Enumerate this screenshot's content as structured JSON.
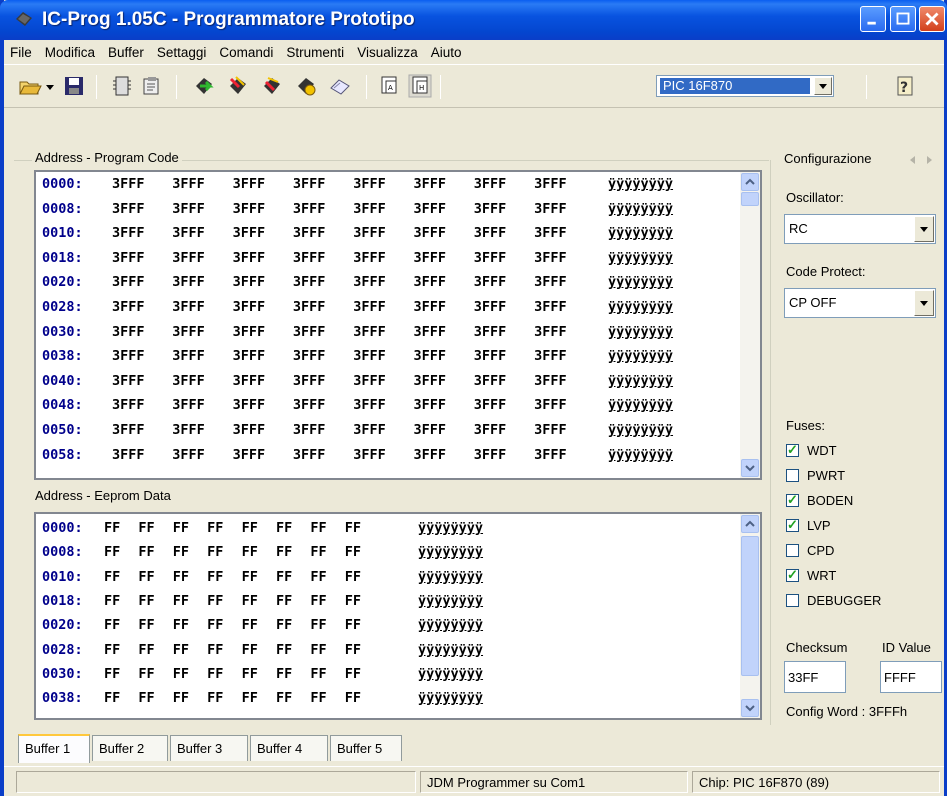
{
  "window": {
    "title": "IC-Prog 1.05C - Programmatore Prototipo"
  },
  "menu": [
    "File",
    "Modifica",
    "Buffer",
    "Settaggi",
    "Comandi",
    "Strumenti",
    "Visualizza",
    "Aiuto"
  ],
  "toolbar": {
    "chip": "PIC 16F870",
    "icons": [
      "open-icon",
      "dropdown-arrow-icon",
      "save-icon",
      "config-icon",
      "settings-icon",
      "read-chip-icon",
      "program-chip-icon",
      "erase-chip-icon",
      "verify-chip-icon",
      "blank-check-icon",
      "view-buffer-icon",
      "view-hex-icon",
      "help-icon"
    ]
  },
  "program_code": {
    "label": "Address - Program Code",
    "rows": [
      {
        "addr": "0000:",
        "words": [
          "3FFF",
          "3FFF",
          "3FFF",
          "3FFF",
          "3FFF",
          "3FFF",
          "3FFF",
          "3FFF"
        ],
        "ascii": "ÿÿÿÿÿÿÿÿ"
      },
      {
        "addr": "0008:",
        "words": [
          "3FFF",
          "3FFF",
          "3FFF",
          "3FFF",
          "3FFF",
          "3FFF",
          "3FFF",
          "3FFF"
        ],
        "ascii": "ÿÿÿÿÿÿÿÿ"
      },
      {
        "addr": "0010:",
        "words": [
          "3FFF",
          "3FFF",
          "3FFF",
          "3FFF",
          "3FFF",
          "3FFF",
          "3FFF",
          "3FFF"
        ],
        "ascii": "ÿÿÿÿÿÿÿÿ"
      },
      {
        "addr": "0018:",
        "words": [
          "3FFF",
          "3FFF",
          "3FFF",
          "3FFF",
          "3FFF",
          "3FFF",
          "3FFF",
          "3FFF"
        ],
        "ascii": "ÿÿÿÿÿÿÿÿ"
      },
      {
        "addr": "0020:",
        "words": [
          "3FFF",
          "3FFF",
          "3FFF",
          "3FFF",
          "3FFF",
          "3FFF",
          "3FFF",
          "3FFF"
        ],
        "ascii": "ÿÿÿÿÿÿÿÿ"
      },
      {
        "addr": "0028:",
        "words": [
          "3FFF",
          "3FFF",
          "3FFF",
          "3FFF",
          "3FFF",
          "3FFF",
          "3FFF",
          "3FFF"
        ],
        "ascii": "ÿÿÿÿÿÿÿÿ"
      },
      {
        "addr": "0030:",
        "words": [
          "3FFF",
          "3FFF",
          "3FFF",
          "3FFF",
          "3FFF",
          "3FFF",
          "3FFF",
          "3FFF"
        ],
        "ascii": "ÿÿÿÿÿÿÿÿ"
      },
      {
        "addr": "0038:",
        "words": [
          "3FFF",
          "3FFF",
          "3FFF",
          "3FFF",
          "3FFF",
          "3FFF",
          "3FFF",
          "3FFF"
        ],
        "ascii": "ÿÿÿÿÿÿÿÿ"
      },
      {
        "addr": "0040:",
        "words": [
          "3FFF",
          "3FFF",
          "3FFF",
          "3FFF",
          "3FFF",
          "3FFF",
          "3FFF",
          "3FFF"
        ],
        "ascii": "ÿÿÿÿÿÿÿÿ"
      },
      {
        "addr": "0048:",
        "words": [
          "3FFF",
          "3FFF",
          "3FFF",
          "3FFF",
          "3FFF",
          "3FFF",
          "3FFF",
          "3FFF"
        ],
        "ascii": "ÿÿÿÿÿÿÿÿ"
      },
      {
        "addr": "0050:",
        "words": [
          "3FFF",
          "3FFF",
          "3FFF",
          "3FFF",
          "3FFF",
          "3FFF",
          "3FFF",
          "3FFF"
        ],
        "ascii": "ÿÿÿÿÿÿÿÿ"
      },
      {
        "addr": "0058:",
        "words": [
          "3FFF",
          "3FFF",
          "3FFF",
          "3FFF",
          "3FFF",
          "3FFF",
          "3FFF",
          "3FFF"
        ],
        "ascii": "ÿÿÿÿÿÿÿÿ"
      }
    ]
  },
  "eeprom": {
    "label": "Address - Eeprom Data",
    "rows": [
      {
        "addr": "0000:",
        "bytes": [
          "FF",
          "FF",
          "FF",
          "FF",
          "FF",
          "FF",
          "FF",
          "FF"
        ],
        "ascii": "ÿÿÿÿÿÿÿÿ"
      },
      {
        "addr": "0008:",
        "bytes": [
          "FF",
          "FF",
          "FF",
          "FF",
          "FF",
          "FF",
          "FF",
          "FF"
        ],
        "ascii": "ÿÿÿÿÿÿÿÿ"
      },
      {
        "addr": "0010:",
        "bytes": [
          "FF",
          "FF",
          "FF",
          "FF",
          "FF",
          "FF",
          "FF",
          "FF"
        ],
        "ascii": "ÿÿÿÿÿÿÿÿ"
      },
      {
        "addr": "0018:",
        "bytes": [
          "FF",
          "FF",
          "FF",
          "FF",
          "FF",
          "FF",
          "FF",
          "FF"
        ],
        "ascii": "ÿÿÿÿÿÿÿÿ"
      },
      {
        "addr": "0020:",
        "bytes": [
          "FF",
          "FF",
          "FF",
          "FF",
          "FF",
          "FF",
          "FF",
          "FF"
        ],
        "ascii": "ÿÿÿÿÿÿÿÿ"
      },
      {
        "addr": "0028:",
        "bytes": [
          "FF",
          "FF",
          "FF",
          "FF",
          "FF",
          "FF",
          "FF",
          "FF"
        ],
        "ascii": "ÿÿÿÿÿÿÿÿ"
      },
      {
        "addr": "0030:",
        "bytes": [
          "FF",
          "FF",
          "FF",
          "FF",
          "FF",
          "FF",
          "FF",
          "FF"
        ],
        "ascii": "ÿÿÿÿÿÿÿÿ"
      },
      {
        "addr": "0038:",
        "bytes": [
          "FF",
          "FF",
          "FF",
          "FF",
          "FF",
          "FF",
          "FF",
          "FF"
        ],
        "ascii": "ÿÿÿÿÿÿÿÿ"
      }
    ]
  },
  "config": {
    "title": "Configurazione",
    "oscillator_label": "Oscillator:",
    "oscillator_value": "RC",
    "code_protect_label": "Code Protect:",
    "code_protect_value": "CP OFF",
    "fuses_label": "Fuses:",
    "fuses": [
      {
        "name": "WDT",
        "checked": true
      },
      {
        "name": "PWRT",
        "checked": false
      },
      {
        "name": "BODEN",
        "checked": true
      },
      {
        "name": "LVP",
        "checked": true
      },
      {
        "name": "CPD",
        "checked": false
      },
      {
        "name": "WRT",
        "checked": true
      },
      {
        "name": "DEBUGGER",
        "checked": false
      }
    ],
    "checksum_label": "Checksum",
    "checksum_value": "33FF",
    "id_label": "ID Value",
    "id_value": "FFFF",
    "config_word": "Config Word : 3FFFh"
  },
  "tabs": [
    "Buffer 1",
    "Buffer 2",
    "Buffer 3",
    "Buffer 4",
    "Buffer 5"
  ],
  "active_tab": 0,
  "status": {
    "programmer": "JDM Programmer su Com1",
    "chip": "Chip: PIC 16F870  (89)"
  },
  "colors": {
    "titlebar": "#0a46d0",
    "address": "#00008b",
    "selection": "#316ac5",
    "check": "#21a121"
  }
}
